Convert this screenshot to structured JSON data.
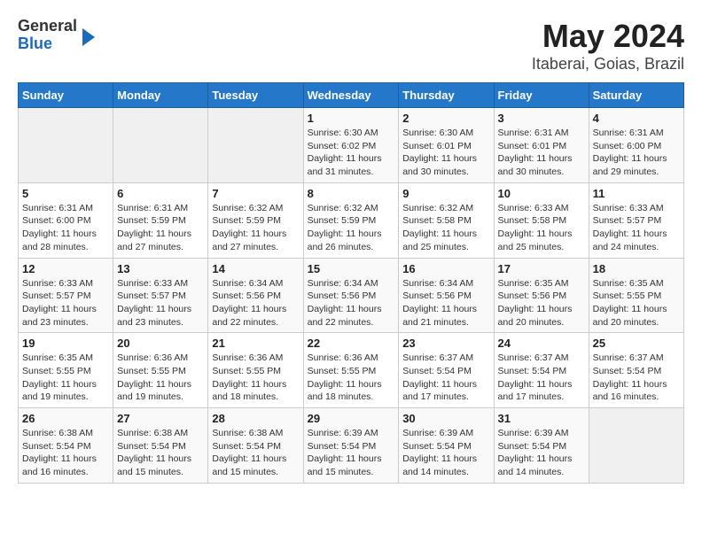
{
  "header": {
    "logo_line1": "General",
    "logo_line2": "Blue",
    "title": "May 2024",
    "subtitle": "Itaberai, Goias, Brazil"
  },
  "days_of_week": [
    "Sunday",
    "Monday",
    "Tuesday",
    "Wednesday",
    "Thursday",
    "Friday",
    "Saturday"
  ],
  "weeks": [
    [
      {
        "day": "",
        "info": ""
      },
      {
        "day": "",
        "info": ""
      },
      {
        "day": "",
        "info": ""
      },
      {
        "day": "1",
        "info": "Sunrise: 6:30 AM\nSunset: 6:02 PM\nDaylight: 11 hours\nand 31 minutes."
      },
      {
        "day": "2",
        "info": "Sunrise: 6:30 AM\nSunset: 6:01 PM\nDaylight: 11 hours\nand 30 minutes."
      },
      {
        "day": "3",
        "info": "Sunrise: 6:31 AM\nSunset: 6:01 PM\nDaylight: 11 hours\nand 30 minutes."
      },
      {
        "day": "4",
        "info": "Sunrise: 6:31 AM\nSunset: 6:00 PM\nDaylight: 11 hours\nand 29 minutes."
      }
    ],
    [
      {
        "day": "5",
        "info": "Sunrise: 6:31 AM\nSunset: 6:00 PM\nDaylight: 11 hours\nand 28 minutes."
      },
      {
        "day": "6",
        "info": "Sunrise: 6:31 AM\nSunset: 5:59 PM\nDaylight: 11 hours\nand 27 minutes."
      },
      {
        "day": "7",
        "info": "Sunrise: 6:32 AM\nSunset: 5:59 PM\nDaylight: 11 hours\nand 27 minutes."
      },
      {
        "day": "8",
        "info": "Sunrise: 6:32 AM\nSunset: 5:59 PM\nDaylight: 11 hours\nand 26 minutes."
      },
      {
        "day": "9",
        "info": "Sunrise: 6:32 AM\nSunset: 5:58 PM\nDaylight: 11 hours\nand 25 minutes."
      },
      {
        "day": "10",
        "info": "Sunrise: 6:33 AM\nSunset: 5:58 PM\nDaylight: 11 hours\nand 25 minutes."
      },
      {
        "day": "11",
        "info": "Sunrise: 6:33 AM\nSunset: 5:57 PM\nDaylight: 11 hours\nand 24 minutes."
      }
    ],
    [
      {
        "day": "12",
        "info": "Sunrise: 6:33 AM\nSunset: 5:57 PM\nDaylight: 11 hours\nand 23 minutes."
      },
      {
        "day": "13",
        "info": "Sunrise: 6:33 AM\nSunset: 5:57 PM\nDaylight: 11 hours\nand 23 minutes."
      },
      {
        "day": "14",
        "info": "Sunrise: 6:34 AM\nSunset: 5:56 PM\nDaylight: 11 hours\nand 22 minutes."
      },
      {
        "day": "15",
        "info": "Sunrise: 6:34 AM\nSunset: 5:56 PM\nDaylight: 11 hours\nand 22 minutes."
      },
      {
        "day": "16",
        "info": "Sunrise: 6:34 AM\nSunset: 5:56 PM\nDaylight: 11 hours\nand 21 minutes."
      },
      {
        "day": "17",
        "info": "Sunrise: 6:35 AM\nSunset: 5:56 PM\nDaylight: 11 hours\nand 20 minutes."
      },
      {
        "day": "18",
        "info": "Sunrise: 6:35 AM\nSunset: 5:55 PM\nDaylight: 11 hours\nand 20 minutes."
      }
    ],
    [
      {
        "day": "19",
        "info": "Sunrise: 6:35 AM\nSunset: 5:55 PM\nDaylight: 11 hours\nand 19 minutes."
      },
      {
        "day": "20",
        "info": "Sunrise: 6:36 AM\nSunset: 5:55 PM\nDaylight: 11 hours\nand 19 minutes."
      },
      {
        "day": "21",
        "info": "Sunrise: 6:36 AM\nSunset: 5:55 PM\nDaylight: 11 hours\nand 18 minutes."
      },
      {
        "day": "22",
        "info": "Sunrise: 6:36 AM\nSunset: 5:55 PM\nDaylight: 11 hours\nand 18 minutes."
      },
      {
        "day": "23",
        "info": "Sunrise: 6:37 AM\nSunset: 5:54 PM\nDaylight: 11 hours\nand 17 minutes."
      },
      {
        "day": "24",
        "info": "Sunrise: 6:37 AM\nSunset: 5:54 PM\nDaylight: 11 hours\nand 17 minutes."
      },
      {
        "day": "25",
        "info": "Sunrise: 6:37 AM\nSunset: 5:54 PM\nDaylight: 11 hours\nand 16 minutes."
      }
    ],
    [
      {
        "day": "26",
        "info": "Sunrise: 6:38 AM\nSunset: 5:54 PM\nDaylight: 11 hours\nand 16 minutes."
      },
      {
        "day": "27",
        "info": "Sunrise: 6:38 AM\nSunset: 5:54 PM\nDaylight: 11 hours\nand 15 minutes."
      },
      {
        "day": "28",
        "info": "Sunrise: 6:38 AM\nSunset: 5:54 PM\nDaylight: 11 hours\nand 15 minutes."
      },
      {
        "day": "29",
        "info": "Sunrise: 6:39 AM\nSunset: 5:54 PM\nDaylight: 11 hours\nand 15 minutes."
      },
      {
        "day": "30",
        "info": "Sunrise: 6:39 AM\nSunset: 5:54 PM\nDaylight: 11 hours\nand 14 minutes."
      },
      {
        "day": "31",
        "info": "Sunrise: 6:39 AM\nSunset: 5:54 PM\nDaylight: 11 hours\nand 14 minutes."
      },
      {
        "day": "",
        "info": ""
      }
    ]
  ]
}
